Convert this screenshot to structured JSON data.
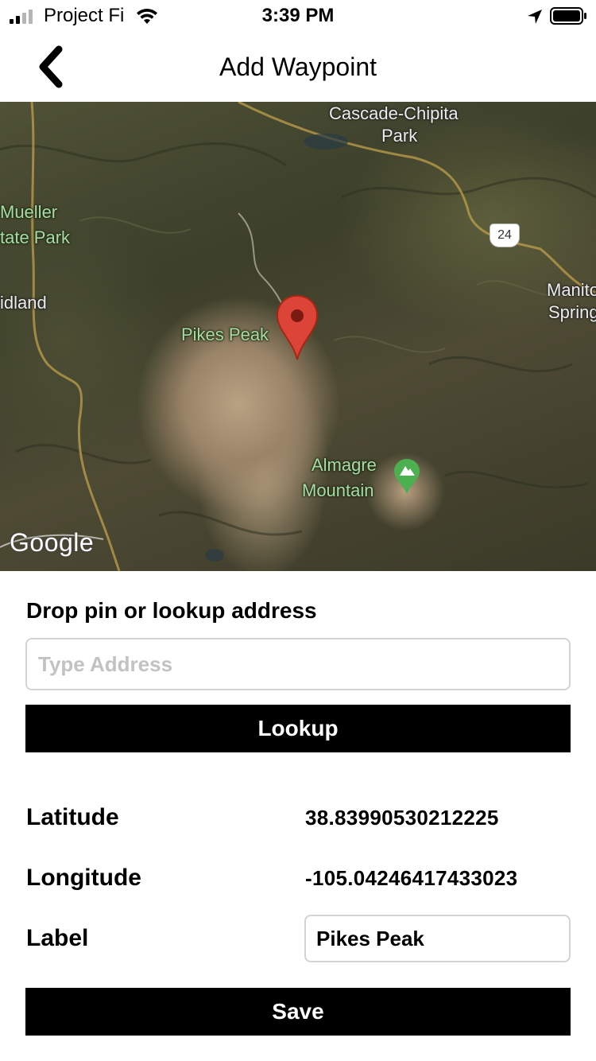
{
  "status_bar": {
    "carrier": "Project Fi",
    "time": "3:39 PM",
    "icons": [
      "signal-icon",
      "wifi-icon",
      "location-arrow-icon",
      "battery-icon"
    ]
  },
  "nav": {
    "title": "Add Waypoint",
    "back_icon": "chevron-left-icon"
  },
  "map": {
    "labels": {
      "cascade_line1": "Cascade-Chipita",
      "cascade_line2": "Park",
      "mueller_line1": "Mueller",
      "mueller_line2": "tate Park",
      "midland": "idland",
      "manitou_line1": "Manito",
      "manitou_line2": "Spring",
      "pikes_peak": "Pikes Peak",
      "almagre_line1": "Almagre",
      "almagre_line2": "Mountain"
    },
    "highway_shield": "24",
    "attribution": "Google",
    "pin_color": "#db4437",
    "park_pin_color": "#5cb85c"
  },
  "form": {
    "section_label": "Drop pin or lookup address",
    "address_placeholder": "Type Address",
    "address_value": "",
    "lookup_button": "Lookup",
    "latitude_label": "Latitude",
    "latitude_value": "38.83990530212225",
    "longitude_label": "Longitude",
    "longitude_value": "-105.04246417433023",
    "label_label": "Label",
    "label_value": "Pikes Peak",
    "save_button": "Save"
  }
}
